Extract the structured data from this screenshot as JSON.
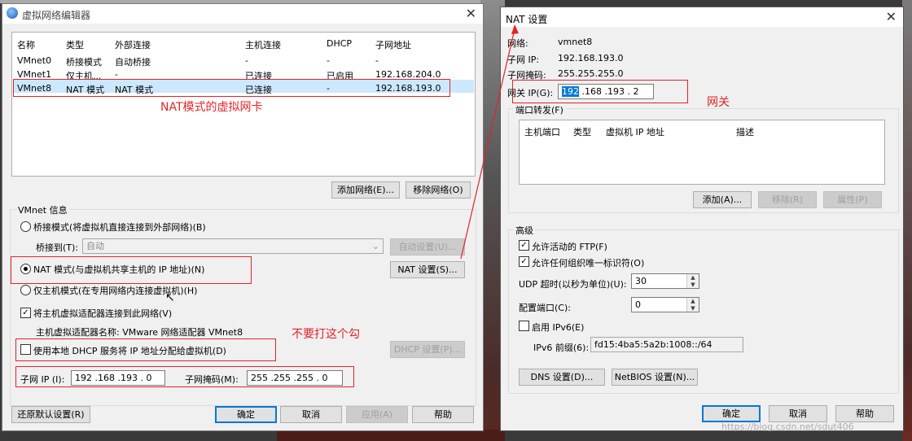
{
  "left_window": {
    "title": "虚拟网络编辑器",
    "columns": [
      "名称",
      "类型",
      "外部连接",
      "主机连接",
      "DHCP",
      "子网地址"
    ],
    "rows": [
      {
        "name": "VMnet0",
        "type": "桥接模式",
        "external": "自动桥接",
        "host": "-",
        "dhcp": "-",
        "subnet": "-"
      },
      {
        "name": "VMnet1",
        "type": "仅主机...",
        "external": "-",
        "host": "已连接",
        "dhcp": "已启用",
        "subnet": "192.168.204.0"
      },
      {
        "name": "VMnet8",
        "type": "NAT 模式",
        "external": "NAT 模式",
        "host": "已连接",
        "dhcp": "-",
        "subnet": "192.168.193.0"
      }
    ],
    "add_network": "添加网络(E)...",
    "remove_network": "移除网络(O)",
    "vmnet_info": "VMnet 信息",
    "bridge_mode": "桥接模式(将虚拟机直接连接到外部网络)(B)",
    "bridge_to_label": "桥接到(T):",
    "bridge_to_value": "自动",
    "auto_settings": "自动设置(U)...",
    "nat_mode": "NAT 模式(与虚拟机共享主机的 IP 地址)(N)",
    "nat_settings": "NAT 设置(S)...",
    "host_only_mode": "仅主机模式(在专用网络内连接虚拟机)(H)",
    "connect_adapter": "将主机虚拟适配器连接到此网络(V)",
    "adapter_name": "主机虚拟适配器名称: VMware 网络适配器 VMnet8",
    "use_dhcp": "使用本地 DHCP 服务将 IP 地址分配给虚拟机(D)",
    "dhcp_settings": "DHCP 设置(P)...",
    "subnet_ip_label": "子网 IP (I):",
    "subnet_ip_value": "192 .168 .193 . 0",
    "subnet_mask_label": "子网掩码(M):",
    "subnet_mask_value": "255 .255 .255 . 0",
    "restore_defaults": "还原默认设置(R)",
    "ok": "确定",
    "cancel": "取消",
    "apply": "应用(A)",
    "help": "帮助"
  },
  "right_window": {
    "title": "NAT 设置",
    "network_label": "网络:",
    "network_value": "vmnet8",
    "subnet_ip_label": "子网 IP:",
    "subnet_ip_value": "192.168.193.0",
    "subnet_mask_label": "子网掩码:",
    "subnet_mask_value": "255.255.255.0",
    "gateway_label": "网关 IP(G):",
    "gateway_first": "192",
    "gateway_rest": " .168 .193 . 2",
    "port_forwarding": "端口转发(F)",
    "pf_columns": [
      "主机端口",
      "类型",
      "虚拟机 IP 地址",
      "描述"
    ],
    "add": "添加(A)...",
    "remove": "移除(R)",
    "properties": "属性(P)",
    "advanced": "高级",
    "allow_ftp": "允许活动的 FTP(F)",
    "allow_uid": "允许任何组织唯一标识符(O)",
    "udp_timeout_label": "UDP 超时(以秒为单位)(U):",
    "udp_timeout_value": "30",
    "config_port_label": "配置端口(C):",
    "config_port_value": "0",
    "enable_ipv6": "启用 IPv6(E)",
    "ipv6_prefix_label": "IPv6 前缀(6):",
    "ipv6_prefix_value": "fd15:4ba5:5a2b:1008::/64",
    "dns_settings": "DNS 设置(D)...",
    "netbios_settings": "NetBIOS 设置(N)...",
    "ok": "确定",
    "cancel": "取消",
    "help": "帮助"
  },
  "annotations": {
    "nat_adapter": "NAT模式的虚拟网卡",
    "gateway": "网关",
    "dont_check": "不要打这个勾"
  },
  "watermark": "https://blog.csdn.net/sdut406",
  "colors": {
    "annotation_red": "#e0242a",
    "selection_blue": "#0078d7",
    "row_highlight": "#cce8ff"
  }
}
